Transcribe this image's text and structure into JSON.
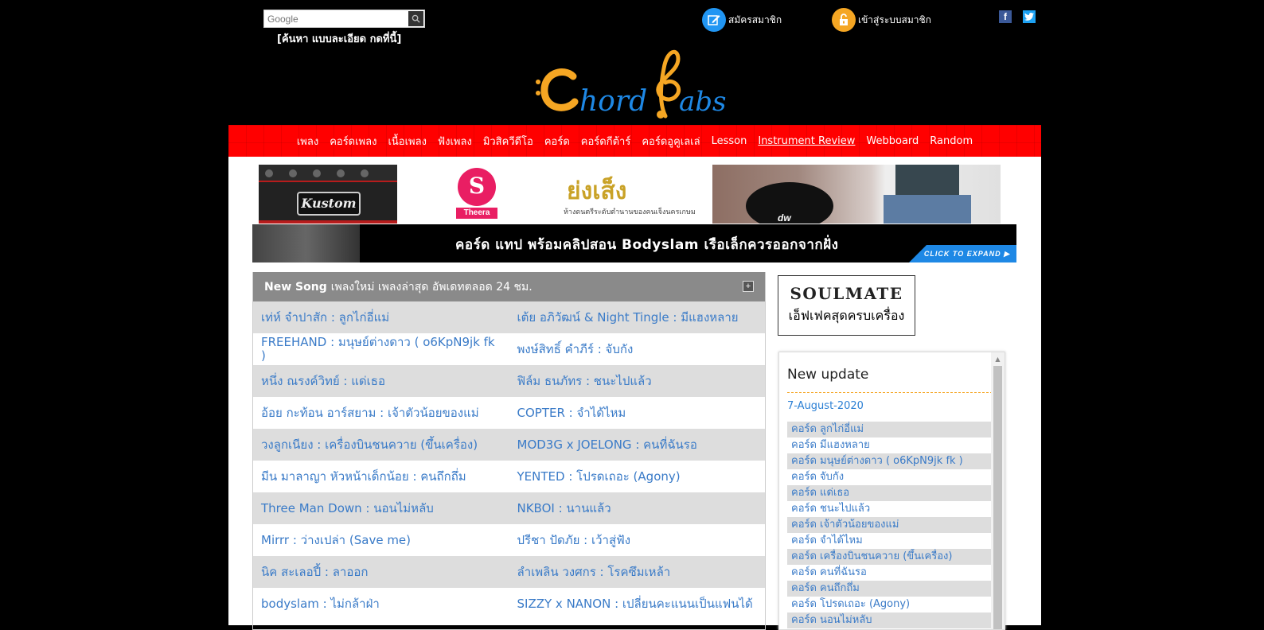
{
  "search": {
    "placeholder": "Google",
    "advanced_label": "[ค้นหา แบบละเอียด กดที่นี้]"
  },
  "header": {
    "register_label": "สมัครสมาชิก",
    "login_label": "เข้าสู่ระบบสมาชิก",
    "logo_text": "ChordTabs"
  },
  "nav": {
    "items": [
      "เพลง",
      "คอร์ดเพลง",
      "เนื้อเพลง",
      "ฟังเพลง",
      "มิวสิควีดีโอ",
      "คอร์ด",
      "คอร์ดกีต้าร์",
      "คอร์ดอูคูเลเล่",
      "Lesson",
      "Instrument Review",
      "Webboard",
      "Random"
    ],
    "active_index": 9
  },
  "ads": {
    "kustom_label": "Kustom",
    "theera_label": "Theera",
    "yongseng_title": "ย่งเส็ง",
    "yongseng_sub": "ห้างดนตรีระดับตำนานของคนเจ็งนครเกษม",
    "dw_label": "dw"
  },
  "banner": {
    "text": "คอร์ด แทป พร้อมคลิปสอน Bodyslam เรือเล็กควรออกจากฝั่ง",
    "expand_label": "CLICK TO EXPAND ▶"
  },
  "song_panel": {
    "title_bold": "New Song",
    "title_rest": "เพลงใหม่ เพลงล่าสุด อัพเดทตลอด 24 ชม.",
    "toggle": "+",
    "rows": [
      [
        "เท่ห์ จำปาสัก : ลูกไก่อี่แม่",
        "เต้ย อภิวัฒน์ & Night Tingle : มีแฮงหลาย"
      ],
      [
        "FREEHAND : มนุษย์ต่างดาว ( o6KpN9jk fk )",
        "พงษ์สิทธิ์ คำภีร์ : จับกัง"
      ],
      [
        "หนึ่ง ณรงค์วิทย์ : แด่เธอ",
        "ฟิล์ม ธนภัทร : ชนะไปแล้ว"
      ],
      [
        "อ้อย กะท้อน อาร์สยาม : เจ้าตัวน้อยของแม่",
        "COPTER : จำได้ไหม"
      ],
      [
        "วงลูกเนียง : เครื่องบินชนควาย (ขึ้นเครื่อง)",
        "MOD3G x JOELONG : คนที่ฉันรอ"
      ],
      [
        "มีน มาลาญา หัวหน้าเด็กน้อย : คนถึกถึ่ม",
        "YENTED : โปรดเถอะ (Agony)"
      ],
      [
        "Three Man Down : นอนไม่หลับ",
        "NKBOI : นานแล้ว"
      ],
      [
        "Mirrr : ว่างเปล่า (Save me)",
        "ปรีชา ปัดภัย : เว้าสู่ฟัง"
      ],
      [
        "นิค สะเลอปี้ : ลาออก",
        "ลำเพลิน วงศกร : โรคซึมเหล้า"
      ],
      [
        "bodyslam : ไม่กล้าฝ่า",
        "SIZZY x NANON : เปลี่ยนคะแนนเป็นแฟนได้"
      ]
    ]
  },
  "soulmate": {
    "title": "SOULMATE",
    "sub": "เอ็ฟเฟคสุดครบเครื่อง"
  },
  "update": {
    "title": "New update",
    "date": "7-August-2020",
    "items": [
      "คอร์ด ลูกไก่อี่แม่",
      "คอร์ด มีแฮงหลาย",
      "คอร์ด มนุษย์ต่างดาว ( o6KpN9jk fk )",
      "คอร์ด จับกัง",
      "คอร์ด แด่เธอ",
      "คอร์ด ชนะไปแล้ว",
      "คอร์ด เจ้าตัวน้อยของแม่",
      "คอร์ด จำได้ไหม",
      "คอร์ด เครื่องบินชนควาย (ขึ้นเครื่อง)",
      "คอร์ด คนที่ฉันรอ",
      "คอร์ด คนถึกถึ่ม",
      "คอร์ด โปรดเถอะ (Agony)",
      "คอร์ด นอนไม่หลับ"
    ]
  },
  "colors": {
    "nav_red": "#ff0000",
    "link_blue": "#3a7bc8",
    "register_icon": "#2196f3",
    "login_icon": "#f5a623"
  },
  "icons": {
    "register": "edit-icon",
    "login": "unlock-icon",
    "facebook": "facebook-icon",
    "twitter": "twitter-icon",
    "search": "search-icon"
  }
}
